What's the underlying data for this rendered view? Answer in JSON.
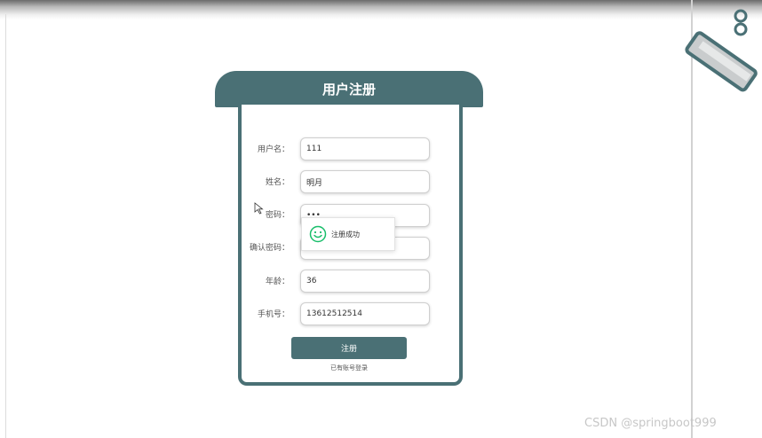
{
  "form": {
    "title": "用户注册",
    "fields": [
      {
        "label": "用户名：",
        "value": "111",
        "type": "text"
      },
      {
        "label": "姓名：",
        "value": "明月",
        "type": "text"
      },
      {
        "label": "密码：",
        "value": "•••",
        "type": "password"
      },
      {
        "label": "确认密码：",
        "value": "",
        "type": "password"
      },
      {
        "label": "年龄：",
        "value": "36",
        "type": "text"
      },
      {
        "label": "手机号：",
        "value": "13612512514",
        "type": "text"
      }
    ],
    "submit_label": "注册",
    "login_link": "已有账号登录"
  },
  "toast": {
    "message": "注册成功",
    "icon": "smiley-icon",
    "icon_color": "#19be6b"
  },
  "watermark": "CSDN @springboot999",
  "colors": {
    "accent": "#4a7075"
  }
}
